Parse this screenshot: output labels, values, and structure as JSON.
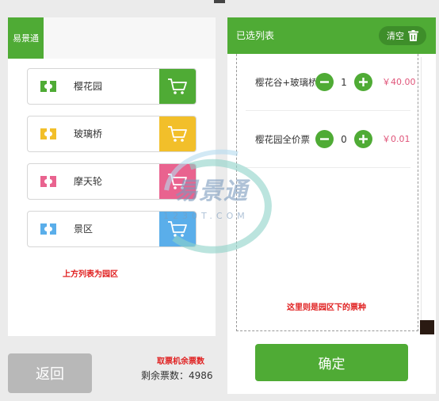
{
  "brand": "易景通",
  "parks": [
    {
      "name": "樱花园",
      "accent": "#4fab35",
      "icon": "ticket-icon"
    },
    {
      "name": "玻璃桥",
      "accent": "#f2bf2a",
      "icon": "ticket-icon"
    },
    {
      "name": "摩天轮",
      "accent": "#e9638f",
      "icon": "ticket-icon"
    },
    {
      "name": "景区",
      "accent": "#5aaeea",
      "icon": "ticket-icon"
    }
  ],
  "notes": {
    "left": "上方列表为园区",
    "right": "这里则是园区下的票种",
    "machine": "取票机余票数"
  },
  "footer": {
    "back_label": "返回",
    "remaining_label": "剩余票数：4986"
  },
  "selected": {
    "title": "已选列表",
    "clear_label": "清空",
    "items": [
      {
        "name": "樱花谷+玻璃桥",
        "qty": "1",
        "price": "￥40.00"
      },
      {
        "name": "樱花园全价票",
        "qty": "0",
        "price": "￥0.01"
      }
    ],
    "confirm_label": "确定"
  },
  "watermark": {
    "text": "易景通",
    "sub": "1230T.COM"
  },
  "colors": {
    "primary": "#4fab35",
    "price": "#e0557a",
    "note": "#e02020"
  }
}
